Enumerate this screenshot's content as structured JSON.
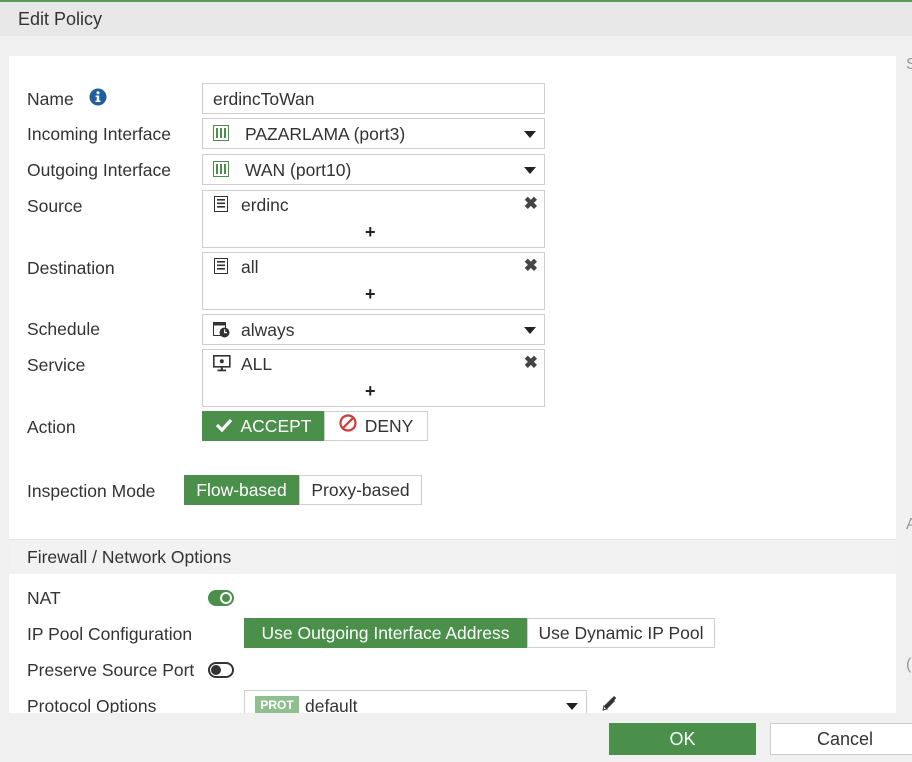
{
  "window": {
    "title": "Edit Policy"
  },
  "form": {
    "name": {
      "label": "Name",
      "value": "erdincToWan"
    },
    "incoming": {
      "label": "Incoming Interface",
      "value": "PAZARLAMA (port3)"
    },
    "outgoing": {
      "label": "Outgoing Interface",
      "value": "WAN (port10)"
    },
    "source": {
      "label": "Source",
      "value": "erdinc",
      "add": "+"
    },
    "destination": {
      "label": "Destination",
      "value": "all",
      "add": "+"
    },
    "schedule": {
      "label": "Schedule",
      "value": "always"
    },
    "service": {
      "label": "Service",
      "value": "ALL",
      "add": "+"
    },
    "action": {
      "label": "Action",
      "accept": "ACCEPT",
      "deny": "DENY",
      "selected": "ACCEPT"
    },
    "inspection": {
      "label": "Inspection Mode",
      "flow": "Flow-based",
      "proxy": "Proxy-based",
      "selected": "Flow-based"
    }
  },
  "firewall_section": {
    "title": "Firewall / Network Options",
    "nat": {
      "label": "NAT",
      "enabled": true
    },
    "ip_pool": {
      "label": "IP Pool Configuration",
      "opt1": "Use Outgoing Interface Address",
      "opt2": "Use Dynamic IP Pool",
      "selected": "Use Outgoing Interface Address"
    },
    "preserve_port": {
      "label": "Preserve Source Port",
      "enabled": false
    },
    "protocol": {
      "label": "Protocol Options",
      "badge": "PROT",
      "value": "default"
    }
  },
  "footer": {
    "ok": "OK",
    "cancel": "Cancel"
  },
  "right_edge": {
    "c1": "S",
    "c2": "A",
    "c3": "("
  },
  "colors": {
    "accent": "#4a8f4a",
    "deny_red": "#d03a3a",
    "info_blue": "#1f5f9f"
  },
  "icons": [
    "info-icon",
    "interface-icon",
    "address-icon",
    "schedule-icon",
    "service-icon",
    "check-icon",
    "deny-icon",
    "edit-pencil-icon"
  ]
}
